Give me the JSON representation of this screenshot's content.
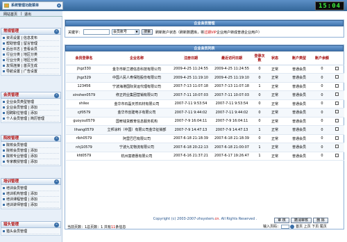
{
  "header": {
    "system_title": "系统管理功能菜单",
    "clock": "15:04",
    "nav_home": "网站首页",
    "nav_exit": "退出"
  },
  "sidebar": {
    "sections": [
      {
        "title": "常规管理",
        "rows": [
          "资讯设置 | 信息发布",
          "帮助管理 | 留言管理",
          "后台日志 | 查看会员",
          "行业分类 | 地区分类",
          "行业分类 | 地区分类",
          "友情连接 | 首页生成",
          "导航设置 | 广告设置"
        ]
      },
      {
        "title": "会员管理",
        "rows": [
          "企业会员类型管理",
          "企业会员管理 | 添加",
          "招聘职位管理 | 添加",
          "个人会员管理 | 简历管理"
        ]
      },
      {
        "title": "院校管理",
        "rows": [
          "院校会员管理",
          "院校会员管理 | 添加",
          "院校专业管理 | 添加",
          "专家教授管理 | 添加"
        ]
      },
      {
        "title": "培训管理",
        "rows": [
          "培训会员管理",
          "培训机构管理 | 添加",
          "培训课程管理 | 添加",
          "培训讲师管理 | 添加"
        ]
      },
      {
        "title": "猎头管理",
        "rows": [
          "猎头会员管理"
        ]
      }
    ]
  },
  "search": {
    "panel_title": "企业会员管理",
    "keyword_label": "关键字：",
    "keyword_value": "",
    "field_selected": "会员账号",
    "search_button": "搜索",
    "note_prefix": "刷新账户状态（刷新数据库，将",
    "note_red": "过期VIP",
    "note_suffix": "企业用户转成普通企业用户）"
  },
  "list": {
    "panel_title": "企业会员列表",
    "columns": [
      "会员登录名",
      "企业名称",
      "注册日期",
      "最近访问日期",
      "登录次数",
      "状态",
      "账户类型",
      "账户余额",
      ""
    ],
    "rows": [
      [
        "jhgz330",
        "金华市新兰德信息科技有限公司",
        "2009-4-25 11:24:55",
        "2009-4-25 11:24:55",
        "0",
        "正常",
        "普通会员",
        "0",
        ""
      ],
      [
        "jhgz329",
        "中国人民人寿保险股份有限公司",
        "2009-4-25 11:19:10",
        "2009-4-25 11:19:10",
        "0",
        "正常",
        "普通会员",
        "0",
        ""
      ],
      [
        "123456",
        "宁波海港国际货运代理有限公司",
        "2007-7-13 11:07:18",
        "2007-7-13 11:07:18",
        "1",
        "正常",
        "普通会员",
        "0",
        ""
      ],
      [
        "xinshen0579",
        "修正药业集团营销有限公司",
        "2007-7-11 10:07:03",
        "2007-7-11 10:07:03",
        "0",
        "正常",
        "普通会员",
        "0",
        ""
      ],
      [
        "shilex",
        "金华市石磊天然石材有限公司",
        "2007-7-11 9:53:54",
        "2007-7-11 9:53:54",
        "0",
        "正常",
        "普通会员",
        "0",
        ""
      ],
      [
        "cjf0579",
        "金华市创建电子有限公司",
        "2007-7-11 9:44:02",
        "2007-7-11 9:44:02",
        "0",
        "正常",
        "普通会员",
        "0",
        ""
      ],
      [
        "guoyou0579",
        "国宥钱货教育信息服务机构",
        "2007-7-9 16:04:11",
        "2007-7-9 16:04:11",
        "0",
        "正常",
        "普通会员",
        "0",
        ""
      ],
      [
        "lihang0579",
        "立邦涂料（中国）有限公司金华征销部",
        "2007-7-9 14:47:13",
        "2007-7-9 14:47:13",
        "1",
        "正常",
        "普通会员",
        "0",
        ""
      ],
      [
        "rlbh0579",
        "阿里巴巴有限公司",
        "2007-6-18 21:18:39",
        "2007-6-18 21:18:39",
        "0",
        "正常",
        "普通会员",
        "0",
        ""
      ],
      [
        "nhj10579",
        "宁波九龙物流有限公司",
        "2007-6-18 20:22:13",
        "2007-6-18 21:00:07",
        "1",
        "正常",
        "普通会员",
        "0",
        ""
      ],
      [
        "kfd0579",
        "杭州富德惠有限公司",
        "2007-6-16 21:37:21",
        "2007-6-17 19:26:47",
        "1",
        "正常",
        "普通会员",
        "0",
        ""
      ]
    ],
    "actions": [
      "审 核",
      "撤消审核",
      "删 除"
    ],
    "pager_prefix": "当前页数：1总页数：1 共有",
    "pager_count": "11",
    "pager_suffix": "条信息",
    "pager_input_label": "输入页码：",
    "pager_links": "首页 上页 下页 尾页"
  },
  "footer": {
    "copyright_prefix": "Copyright (c) 2003-2007-zhsystem.",
    "copyright_cn": "cn",
    "copyright_suffix": ". All Rights Reserved ."
  }
}
